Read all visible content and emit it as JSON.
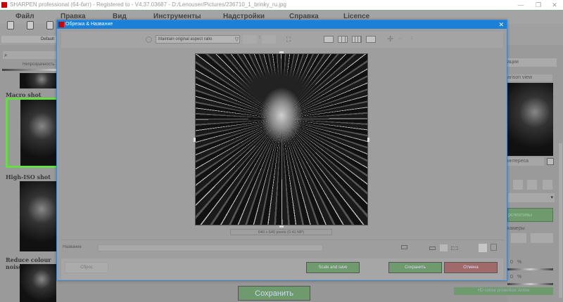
{
  "app": {
    "title": "SHARPEN professional (64-бит) - Registered to - V4.37.03687 - D:/Lenouser/Pictures/236710_1_brinky_ru.jpg",
    "win_min": "—",
    "win_max": "❐",
    "win_close": "✕"
  },
  "menu": [
    "Файл",
    "Правка",
    "Вид",
    "Инструменты",
    "Надстройки",
    "Справка",
    "Licence"
  ],
  "left": {
    "default_label": "Default",
    "opacity_label": "Непрозрачность",
    "presets": [
      "Macro shot",
      "High-ISO shot",
      "Reduce colour noise"
    ]
  },
  "dialog": {
    "title": "Обрезка & Название",
    "aspect_select": "Maintain original aspect ratio",
    "ratio_sep": ":",
    "size_label": "640 x 640 pixels (0.41 MP)",
    "name_label": "Название",
    "name_value": "",
    "reset": "Сброс",
    "scale_save": "Scale and save",
    "save": "Сохранить",
    "cancel": "Отмена",
    "close": "✕"
  },
  "right": {
    "search_partial": "ации",
    "comparison_partial": "arison view",
    "interest_partial": "интереса",
    "perspective_partial": "рспективы",
    "camera_partial": "камеры",
    "pct1": "0",
    "pct2": "0",
    "pct_sign": "%",
    "hd": "HD colour protection: Active"
  },
  "main": {
    "save_button": "Сохранить"
  },
  "colors": {
    "accent": "#1a80d8",
    "green": "#6e9a6e",
    "red": "#a06a6a",
    "selected": "#66dd44"
  }
}
